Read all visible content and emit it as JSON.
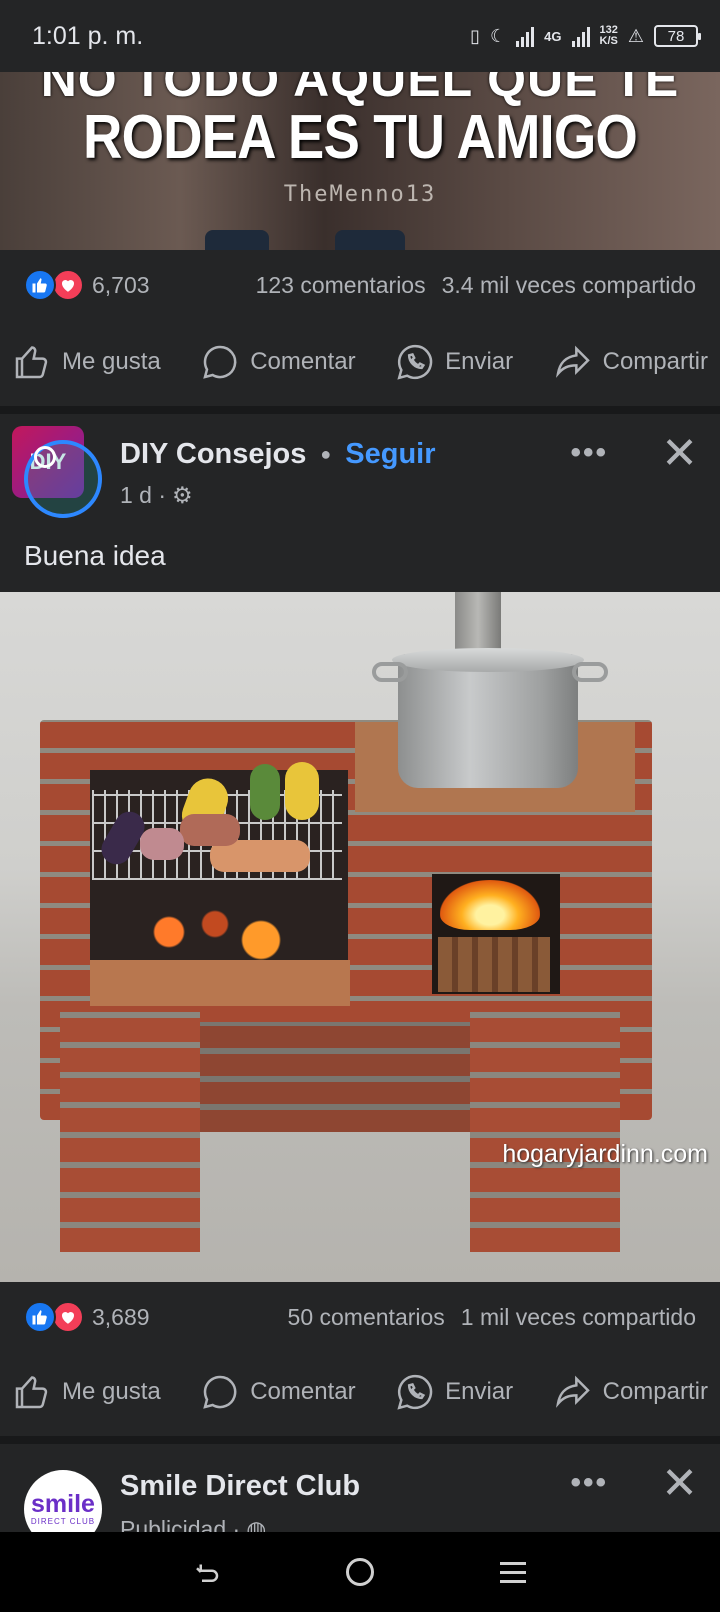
{
  "status_bar": {
    "time": "1:01 p. m.",
    "network": "4G",
    "speed_top": "132",
    "speed_bottom": "K/S",
    "battery": "78"
  },
  "meme_post": {
    "image_text_top": "NO TODO AQUEL QUE TE",
    "image_text": "RODEA ES TU AMIGO",
    "image_credit": "TheMenno13",
    "reaction_count": "6,703",
    "comments": "123 comentarios",
    "shares": "3.4 mil veces compartido"
  },
  "actions": {
    "like": "Me gusta",
    "comment": "Comentar",
    "send": "Enviar",
    "share": "Compartir"
  },
  "diy_post": {
    "page_name": "DIY Consejos",
    "follow_label": "Seguir",
    "time": "1 d ·",
    "more": "•••",
    "close": "✕",
    "avatar_text": "DIY",
    "caption": "Buena idea",
    "watermark": "hogaryjardinn.com",
    "reaction_count": "3,689",
    "comments": "50 comentarios",
    "shares": "1 mil veces compartido"
  },
  "ad_post": {
    "page_name": "Smile Direct Club",
    "meta": "Publicidad ·",
    "avatar_line1": "smile",
    "avatar_line2": "DIRECT CLUB",
    "more": "•••",
    "close": "✕"
  },
  "icons": [
    "like-reaction-icon",
    "love-reaction-icon",
    "thumbs-up-icon",
    "comment-icon",
    "whatsapp-icon",
    "share-icon",
    "gear-icon",
    "globe-icon",
    "back-icon",
    "home-icon",
    "recents-icon"
  ],
  "colors": {
    "background": "#242526",
    "accent": "#4599ff",
    "like": "#1877f2",
    "love": "#f33e58"
  }
}
